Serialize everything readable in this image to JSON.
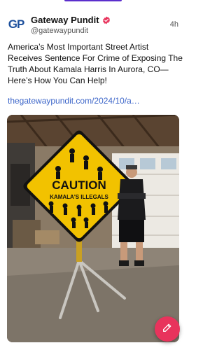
{
  "post": {
    "author_name": "Gateway Pundit",
    "author_handle": "@gatewaypundit",
    "avatar_text": "GP",
    "timestamp": "4h",
    "text": "America’s Most Important Street Artist Receives Sentence For Crime of Exposing The Truth About Kamala Harris In Aurora, CO—Here’s How You Can Help!",
    "link": "thegatewaypundit.com/2024/10/a…",
    "image": {
      "sign_top": "CAUTION",
      "sign_bottom": "KAMALA'S ILLEGALS"
    }
  },
  "colors": {
    "accent": "#5b2ecc",
    "link": "#3d66c9",
    "fab": "#e8335c",
    "verified": "#e8335c",
    "sign_yellow": "#f2c200"
  },
  "icons": {
    "verified": "verified-badge-icon",
    "compose": "compose-icon"
  }
}
